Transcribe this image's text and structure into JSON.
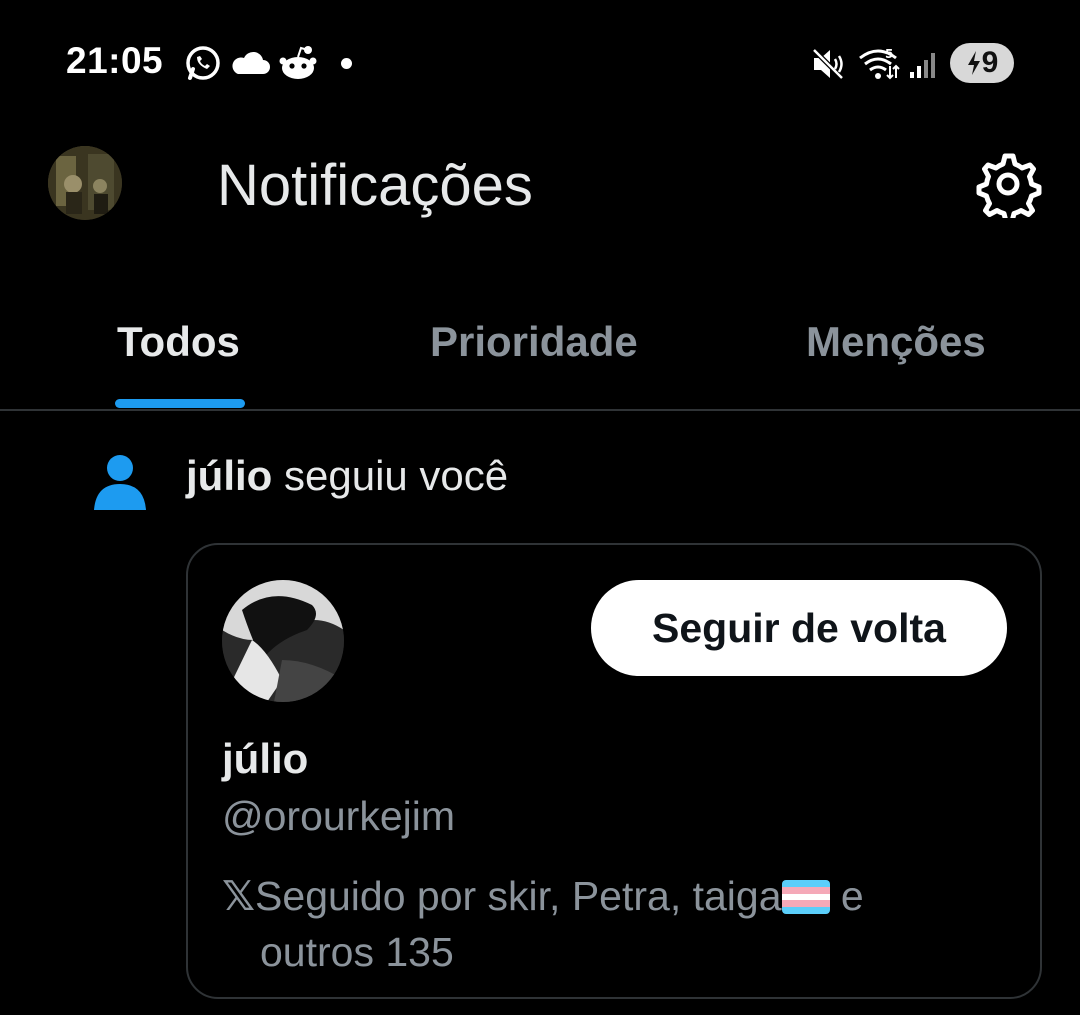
{
  "status_bar": {
    "time": "21:05",
    "battery_level": "9",
    "icons": [
      "whatsapp-icon",
      "cloud-icon",
      "reddit-icon",
      "dot-icon",
      "mute-icon",
      "wifi-icon",
      "signal-icon",
      "battery-charging-icon"
    ]
  },
  "header": {
    "title": "Notificações"
  },
  "tabs": [
    {
      "label": "Todos",
      "active": true
    },
    {
      "label": "Prioridade",
      "active": false
    },
    {
      "label": "Menções",
      "active": false
    }
  ],
  "notification": {
    "actor": "júlio",
    "action": " seguiu você",
    "card": {
      "name": "júlio",
      "handle": "@orourkejim",
      "follow_button": "Seguir de volta",
      "x_symbol": "𝕏",
      "followed_by_text": "Seguido por skir, Petra, taiga",
      "followed_by_suffix": " e",
      "followed_by_line2": "outros 135"
    }
  },
  "colors": {
    "accent": "#1d9bf0",
    "background": "#000000",
    "muted_text": "#8b939b",
    "primary_text": "#e7e9ea"
  }
}
